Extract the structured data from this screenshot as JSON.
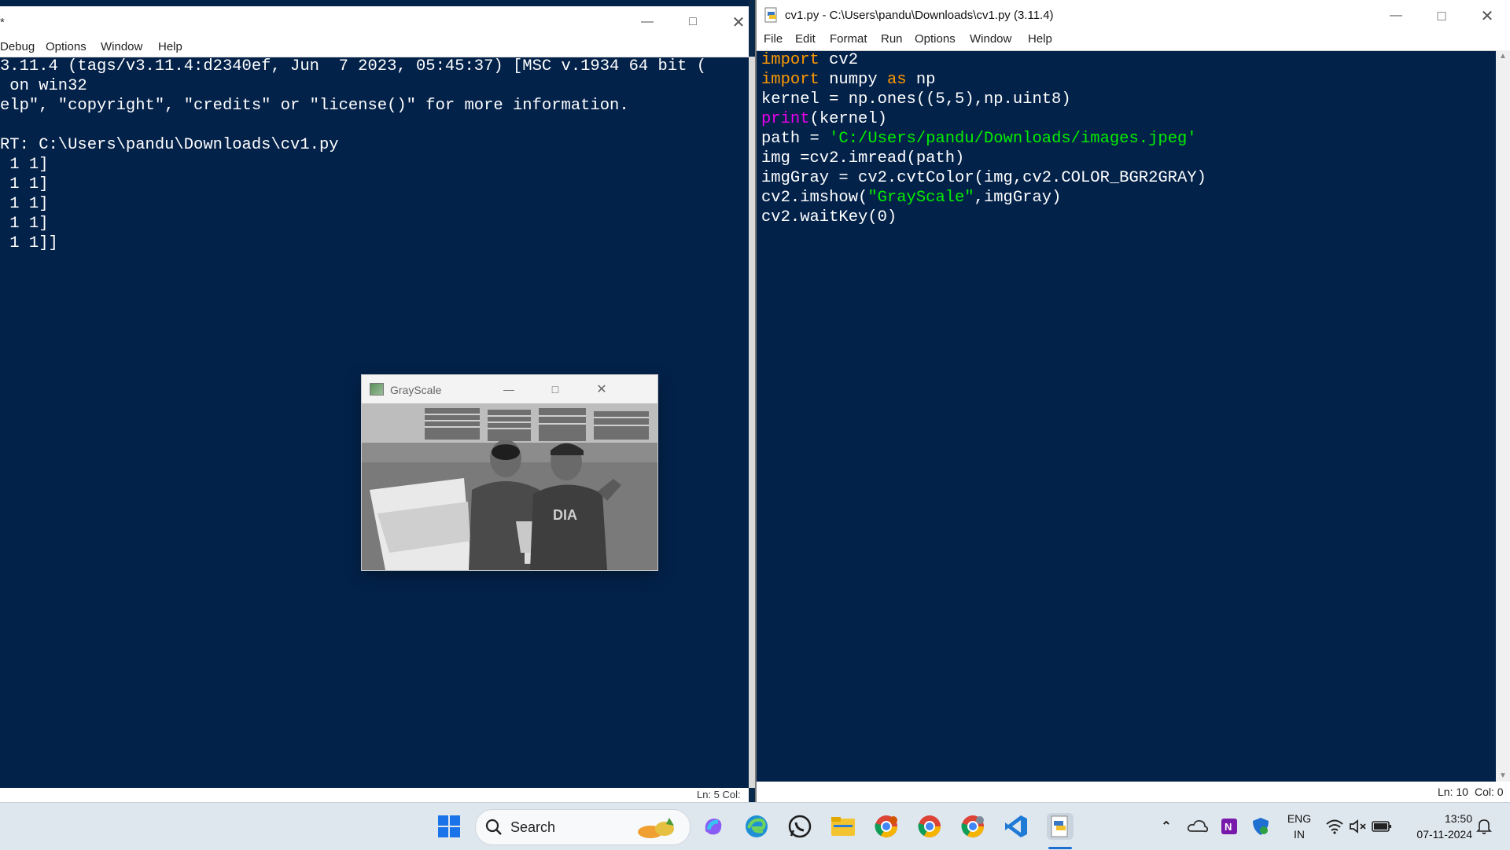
{
  "shell": {
    "title": "*",
    "menu": [
      "Debug",
      "Options",
      "Window",
      "Help"
    ],
    "output_lines": [
      "3.11.4 (tags/v3.11.4:d2340ef, Jun  7 2023, 05:45:37) [MSC v.1934 64 bit (",
      " on win32",
      "elp\", \"copyright\", \"credits\" or \"license()\" for more information.",
      "",
      "RT: C:\\Users\\pandu\\Downloads\\cv1.py",
      " 1 1]",
      " 1 1]",
      " 1 1]",
      " 1 1]",
      " 1 1]]"
    ],
    "status": "Ln: 5   Col:"
  },
  "editor": {
    "title": "cv1.py - C:\\Users\\pandu\\Downloads\\cv1.py (3.11.4)",
    "menu": [
      "File",
      "Edit",
      "Format",
      "Run",
      "Options",
      "Window",
      "Help"
    ],
    "code": {
      "l1_kw": "import",
      "l1_rest": " cv2",
      "l2_kw": "import",
      "l2_mid": " numpy ",
      "l2_kw2": "as",
      "l2_rest": " np",
      "l3": "kernel = np.ones((5,5),np.uint8)",
      "l4_bi": "print",
      "l4_rest": "(kernel)",
      "l5_pre": "path = ",
      "l5_str": "'C:/Users/pandu/Downloads/images.jpeg'",
      "l6": "img =cv2.imread(path)",
      "l7": "imgGray = cv2.cvtColor(img,cv2.COLOR_BGR2GRAY)",
      "l8_pre": "cv2.imshow(",
      "l8_str": "\"GrayScale\"",
      "l8_rest": ",imgGray)",
      "l9": "cv2.waitKey(0)"
    },
    "status_ln": "Ln: 10",
    "status_col": "Col: 0"
  },
  "grayscale_window": {
    "title": "GrayScale"
  },
  "taskbar": {
    "search_label": "Search",
    "lang_top": "ENG",
    "lang_bottom": "IN",
    "time": "13:50",
    "date": "07-11-2024"
  },
  "colors": {
    "background": "#03224a",
    "keyword": "#ff9900",
    "builtin": "#ee00ee",
    "string": "#00ee00"
  },
  "icons": [
    "minimize-icon",
    "maximize-icon",
    "close-icon",
    "windows-start-icon",
    "search-icon",
    "copilot-icon",
    "edge-icon",
    "whatsapp-icon",
    "file-explorer-icon",
    "chrome-icon",
    "vscode-icon",
    "python-idle-icon",
    "chevron-up-icon",
    "onedrive-icon",
    "onenote-icon",
    "defender-icon",
    "wifi-icon",
    "speaker-muted-icon",
    "battery-icon",
    "notification-bell-icon"
  ]
}
